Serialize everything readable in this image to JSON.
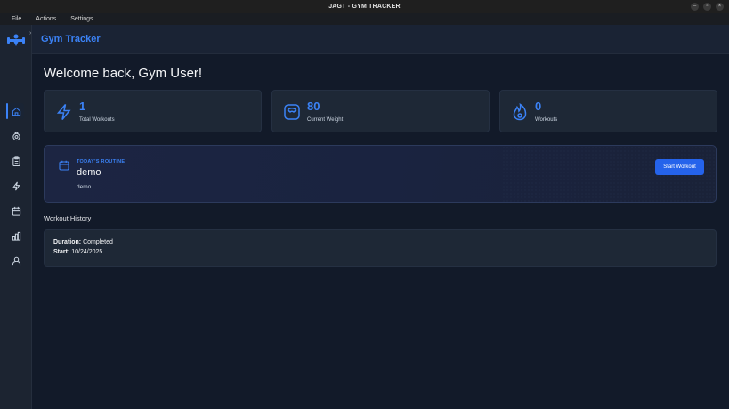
{
  "window": {
    "title": "JAGT - GYM TRACKER",
    "controls": [
      "–",
      "▫",
      "×"
    ]
  },
  "menu": {
    "items": [
      "File",
      "Actions",
      "Settings"
    ]
  },
  "header": {
    "title": "Gym Tracker"
  },
  "sidebar": {
    "expand_glyph": "›",
    "items": [
      {
        "icon": "home-icon",
        "active": true
      },
      {
        "icon": "exercise-icon",
        "active": false
      },
      {
        "icon": "clipboard-icon",
        "active": false
      },
      {
        "icon": "lightning-icon",
        "active": false
      },
      {
        "icon": "calendar-icon",
        "active": false
      },
      {
        "icon": "bar-chart-icon",
        "active": false
      },
      {
        "icon": "user-icon",
        "active": false
      }
    ]
  },
  "main": {
    "welcome": "Welcome back, Gym User!",
    "stats": [
      {
        "value": "1",
        "label": "Total Workouts",
        "icon": "lightning-icon"
      },
      {
        "value": "80",
        "label": "Current Weight",
        "icon": "scale-icon"
      },
      {
        "value": "0",
        "label": "Workouts",
        "icon": "flame-icon"
      }
    ],
    "routine": {
      "tag": "TODAY'S ROUTINE",
      "name": "demo",
      "description": "demo",
      "button": "Start Workout"
    },
    "history": {
      "title": "Workout History",
      "entries": [
        {
          "duration_label": "Duration:",
          "duration_value": "Completed",
          "start_label": "Start:",
          "start_value": "10/24/2025"
        }
      ]
    }
  },
  "colors": {
    "accent": "#3b82f6",
    "button": "#2563eb",
    "background": "#121a29",
    "card": "#1e2836"
  }
}
